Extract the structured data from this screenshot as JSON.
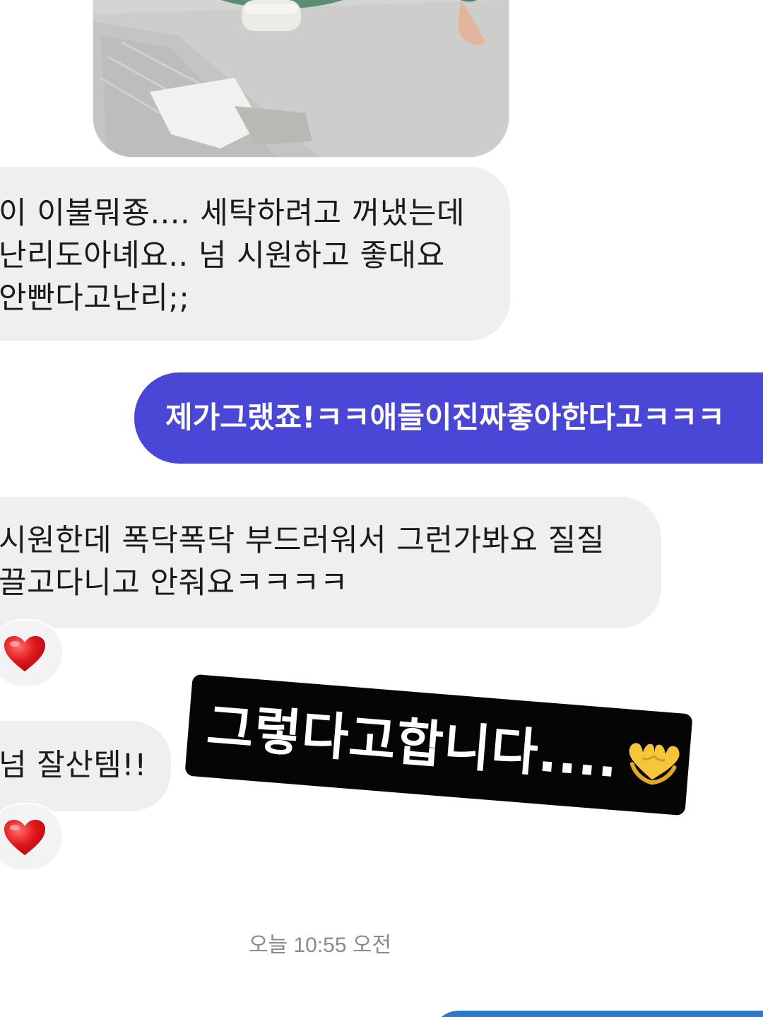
{
  "conversation": {
    "messages": [
      {
        "direction": "incoming",
        "type": "image"
      },
      {
        "direction": "incoming",
        "type": "text",
        "lines": [
          "이 이불뭐죵.... 세탁하려고 꺼냈는데",
          "난리도아녜요.. 넘 시원하고 좋대요",
          "안빤다고난리;;"
        ]
      },
      {
        "direction": "outgoing",
        "type": "text",
        "text": "제가그랬죠!ㅋㅋ애들이진짜좋아한다고ㅋㅋㅋ"
      },
      {
        "direction": "incoming",
        "type": "text",
        "lines": [
          "시원한데 폭닥폭닥 부드러워서 그런가봐요 질질",
          "끌고다니고 안줘요ㅋㅋㅋㅋ"
        ],
        "reaction": "heart"
      },
      {
        "direction": "incoming",
        "type": "text",
        "lines": [
          "넘 잘산템!!"
        ],
        "reaction": "heart"
      }
    ],
    "timestamp": "오늘 10:55 오전"
  },
  "sticker": {
    "text": "그렇다고합니다....",
    "emoji": "heart-hands"
  },
  "colors": {
    "outgoing_bubble": "#4b47d6",
    "incoming_bubble": "#efefef",
    "timestamp_text": "#8a8a8a",
    "sticker_background": "#050505",
    "next_outgoing_bubble": "#2f79c9"
  }
}
